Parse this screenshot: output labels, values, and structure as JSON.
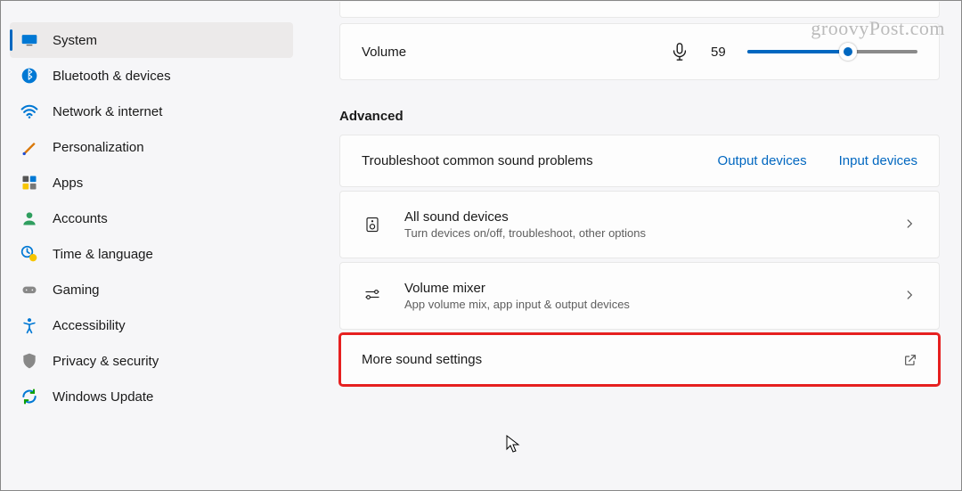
{
  "sidebar": {
    "items": [
      {
        "label": "System",
        "selected": true
      },
      {
        "label": "Bluetooth & devices"
      },
      {
        "label": "Network & internet"
      },
      {
        "label": "Personalization"
      },
      {
        "label": "Apps"
      },
      {
        "label": "Accounts"
      },
      {
        "label": "Time & language"
      },
      {
        "label": "Gaming"
      },
      {
        "label": "Accessibility"
      },
      {
        "label": "Privacy & security"
      },
      {
        "label": "Windows Update"
      }
    ]
  },
  "main": {
    "volume": {
      "label": "Volume",
      "value": 59
    },
    "section_advanced": "Advanced",
    "troubleshoot": {
      "title": "Troubleshoot common sound problems",
      "link1": "Output devices",
      "link2": "Input devices"
    },
    "all_devices": {
      "title": "All sound devices",
      "sub": "Turn devices on/off, troubleshoot, other options"
    },
    "mixer": {
      "title": "Volume mixer",
      "sub": "App volume mix, app input & output devices"
    },
    "more": {
      "title": "More sound settings"
    }
  },
  "watermark": "groovyPost.com"
}
